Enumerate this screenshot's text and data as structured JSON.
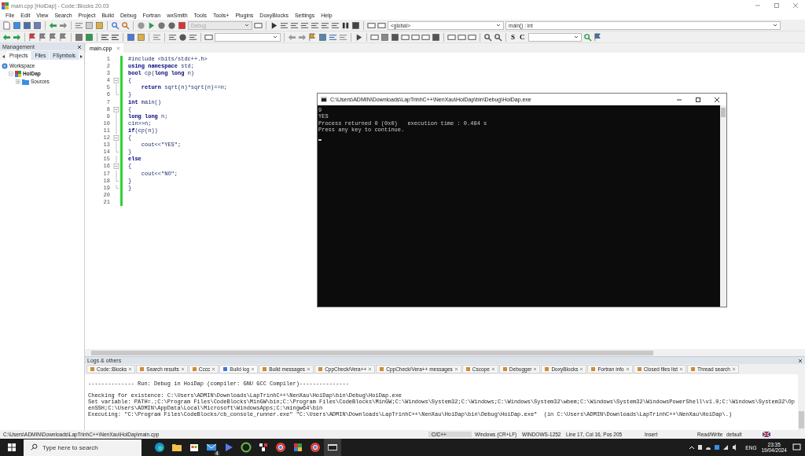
{
  "window": {
    "title": "main.cpp [HoiDap] - Code::Blocks 20.03"
  },
  "menu": [
    "File",
    "Edit",
    "View",
    "Search",
    "Project",
    "Build",
    "Debug",
    "Fortran",
    "wxSmith",
    "Tools",
    "Tools+",
    "Plugins",
    "DoxyBlocks",
    "Settings",
    "Help"
  ],
  "toolbar": {
    "build_target": {
      "value": "Debug",
      "disabled": true
    },
    "scope": {
      "value": "<global>"
    },
    "function": {
      "value": "main() : int"
    },
    "letter_buttons": [
      "S",
      "C"
    ]
  },
  "management": {
    "title": "Management",
    "tabs": [
      {
        "label": "Projects",
        "selected": true
      },
      {
        "label": "Files",
        "selected": false
      },
      {
        "label": "FSymbols",
        "selected": false
      }
    ],
    "tree": [
      {
        "label": "Workspace",
        "kind": "workspace",
        "children": [
          {
            "label": "HoiDap",
            "kind": "project",
            "expanded": true,
            "children": [
              {
                "label": "Sources",
                "kind": "folder",
                "expanded": false
              }
            ]
          }
        ]
      }
    ]
  },
  "editor": {
    "tabs": [
      {
        "label": "main.cpp",
        "selected": true
      }
    ],
    "lines": [
      {
        "no": "1",
        "kind": "plain",
        "text": "#include <bits/stdc++.h>"
      },
      {
        "no": "2",
        "kind": "plain",
        "text": "**using namespace** std;"
      },
      {
        "no": "3",
        "kind": "plain",
        "text": "**bool** cp(**long long** n)"
      },
      {
        "no": "4",
        "kind": "fold-start",
        "text": "{"
      },
      {
        "no": "5",
        "kind": "fold-body",
        "text": "    **return** sqrt(n)*sqrt(n)==n;"
      },
      {
        "no": "6",
        "kind": "fold-end",
        "text": "}"
      },
      {
        "no": "7",
        "kind": "plain",
        "text": "**int** main()"
      },
      {
        "no": "8",
        "kind": "fold-start",
        "text": "{"
      },
      {
        "no": "9",
        "kind": "fold-body",
        "text": "**long long** n;"
      },
      {
        "no": "10",
        "kind": "fold-body",
        "text": "cin>>n;"
      },
      {
        "no": "11",
        "kind": "fold-body",
        "text": "**if**(cp(n))"
      },
      {
        "no": "12",
        "kind": "fold-start",
        "text": "{"
      },
      {
        "no": "13",
        "kind": "fold-body",
        "text": "    cout<<\"YES\";"
      },
      {
        "no": "14",
        "kind": "fold-end",
        "text": "}"
      },
      {
        "no": "15",
        "kind": "fold-body",
        "text": "**else**"
      },
      {
        "no": "16",
        "kind": "fold-start",
        "text": "{"
      },
      {
        "no": "17",
        "kind": "fold-body",
        "text": "    cout<<\"NO\";"
      },
      {
        "no": "18",
        "kind": "fold-end",
        "text": "}"
      },
      {
        "no": "19",
        "kind": "fold-end",
        "text": "}"
      },
      {
        "no": "20",
        "kind": "plain"
      },
      {
        "no": "21",
        "kind": "plain"
      }
    ]
  },
  "logs": {
    "title": "Logs & others",
    "tabs": [
      {
        "label": "Code::Blocks",
        "selected": false
      },
      {
        "label": "Search results",
        "selected": false
      },
      {
        "label": "Cccc",
        "selected": false
      },
      {
        "label": "Build log",
        "selected": true
      },
      {
        "label": "Build messages",
        "selected": false
      },
      {
        "label": "CppCheck/Vera++",
        "selected": false
      },
      {
        "label": "CppCheck/Vera++ messages",
        "selected": false
      },
      {
        "label": "Cscope",
        "selected": false
      },
      {
        "label": "Debugger",
        "selected": false
      },
      {
        "label": "DoxyBlocks",
        "selected": false
      },
      {
        "label": "Fortran info",
        "selected": false
      },
      {
        "label": "Closed files list",
        "selected": false
      },
      {
        "label": "Thread search",
        "selected": false
      }
    ],
    "lines": [
      "-------------- Run: Debug in HoiDap (compiler: GNU GCC Compiler)---------------",
      "Checking for existence: C:\\Users\\ADMIN\\Downloads\\LapTrinhC++\\NenXau\\HoiDap\\bin\\Debug\\HoiDap.exe",
      "Set variable: PATH=.;C:\\Program Files\\CodeBlocks\\MinGW\\bin;C:\\Program Files\\CodeBlocks\\MinGW;C:\\Windows\\System32;C:\\Windows;C:\\Windows\\System32\\wbem;C:\\Windows\\System32\\WindowsPowerShell\\v1.0;C:\\Windows\\System32\\OpenSSH;C:\\Users\\ADMIN\\AppData\\Local\\Microsoft\\WindowsApps;C:\\mingw64\\bin",
      "Executing: \"C:\\Program Files\\CodeBlocks/cb_console_runner.exe\" \"C:\\Users\\ADMIN\\Downloads\\LapTrinhC++\\NenXau\\HoiDap\\bin\\Debug\\HoiDap.exe\"  (in C:\\Users\\ADMIN\\Downloads\\LapTrinhC++\\NenXau\\HoiDap\\.)"
    ]
  },
  "status_bar": {
    "path": "C:\\Users\\ADMIN\\Downloads\\LapTrinhC++\\NenXau\\HoiDap\\main.cpp",
    "language": "C/C++",
    "line_endings": "Windows (CR+LF)",
    "encoding": "WINDOWS-1252",
    "position": "Line 17, Col 16, Pos 205",
    "mode": "Insert",
    "access": "Read/Write",
    "profile": "default"
  },
  "console": {
    "title": "C:\\Users\\ADMIN\\Downloads\\LapTrinhC++\\NenXau\\HoiDap\\bin\\Debug\\HoiDap.exe",
    "lines": [
      "9",
      "YES",
      "Process returned 0 (0x0)   execution time : 0.484 s",
      "Press any key to continue."
    ]
  },
  "taskbar": {
    "search": {
      "placeholder": "Type here to search"
    },
    "mail_badge": "4",
    "language": "ENG",
    "time": "23:35",
    "date": "19/04/2024"
  }
}
